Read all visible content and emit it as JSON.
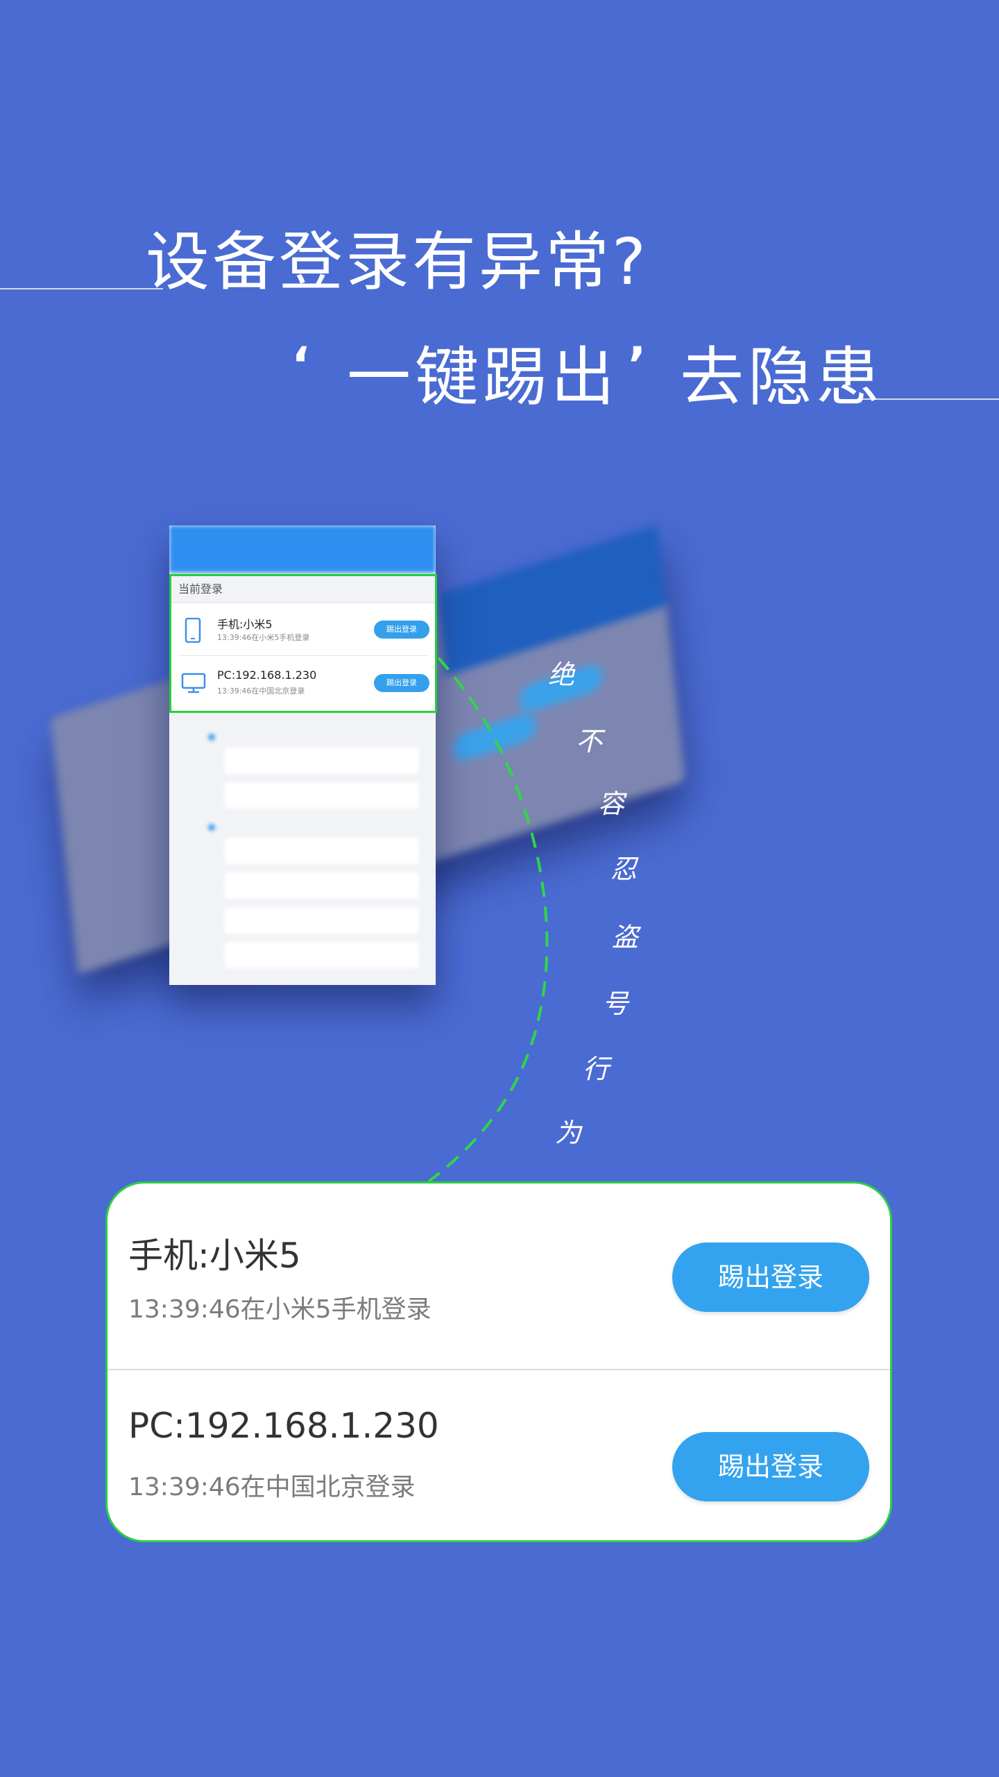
{
  "headline": {
    "line1": "设备登录有异常?",
    "quote_open": "‘",
    "quote_close": "’",
    "line2_emphasis": "一键踢出",
    "line2_rest": "去隐患"
  },
  "slogan_chars": [
    "绝",
    "不",
    "容",
    "忍",
    "盗",
    "号",
    "行",
    "为"
  ],
  "mockup": {
    "section_label": "当前登录",
    "items": [
      {
        "title": "手机:小米5",
        "subtitle": "13:39:46在小米5手机登录",
        "button": "踢出登录",
        "icon": "phone-icon"
      },
      {
        "title": "PC:192.168.1.230",
        "subtitle": "13:39:46在中国北京登录",
        "button": "踢出登录",
        "icon": "monitor-icon"
      }
    ]
  },
  "card": {
    "items": [
      {
        "title": "手机:小米5",
        "subtitle": "13:39:46在小米5手机登录",
        "button": "踢出登录"
      },
      {
        "title": "PC:192.168.1.230",
        "subtitle": "13:39:46在中国北京登录",
        "button": "踢出登录"
      }
    ]
  },
  "colors": {
    "background": "#4a6bd2",
    "accent_green": "#2bcf43",
    "button_blue": "#33a3ef"
  }
}
